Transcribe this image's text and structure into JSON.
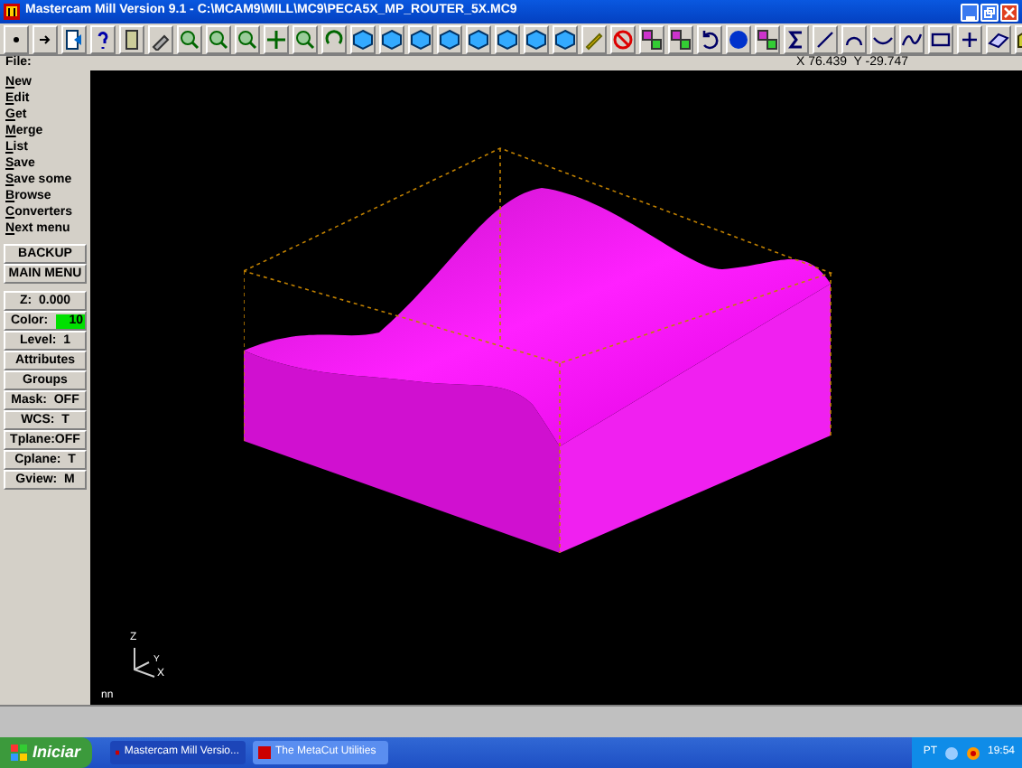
{
  "window": {
    "title": "Mastercam Mill Version 9.1 - C:\\MCAM9\\MILL\\MC9\\PECA5X_MP_ROUTER_5X.MC9"
  },
  "prompt": "File:",
  "coordinates": "X 76.439  Y -29.747",
  "menu_items": [
    "New",
    "Edit",
    "Get",
    "Merge",
    "List",
    "Save",
    "Save some",
    "Browse",
    "Converters",
    "Next menu"
  ],
  "menu_buttons": [
    "BACKUP",
    "MAIN MENU"
  ],
  "status_items": [
    {
      "kind": "text",
      "label": "Z:  0.000"
    },
    {
      "kind": "color",
      "label": "Color:",
      "value": "10",
      "color": "#00e000"
    },
    {
      "kind": "text",
      "label": "Level:  1"
    },
    {
      "kind": "text",
      "label": "Attributes"
    },
    {
      "kind": "text",
      "label": "Groups"
    },
    {
      "kind": "text",
      "label": "Mask:  OFF"
    },
    {
      "kind": "text",
      "label": "WCS:  T"
    },
    {
      "kind": "text",
      "label": "Tplane:OFF"
    },
    {
      "kind": "text",
      "label": "Cplane:  T"
    },
    {
      "kind": "text",
      "label": "Gview:  M"
    }
  ],
  "viewport": {
    "axes": [
      "Z",
      "Y",
      "X"
    ],
    "label": "nn"
  },
  "taskbar": {
    "start": "Iniciar",
    "tasks": [
      {
        "label": "Mastercam Mill Versio...",
        "selected": false
      },
      {
        "label": "The MetaCut Utilities",
        "selected": true
      }
    ],
    "language": "PT",
    "clock": "19:54"
  }
}
